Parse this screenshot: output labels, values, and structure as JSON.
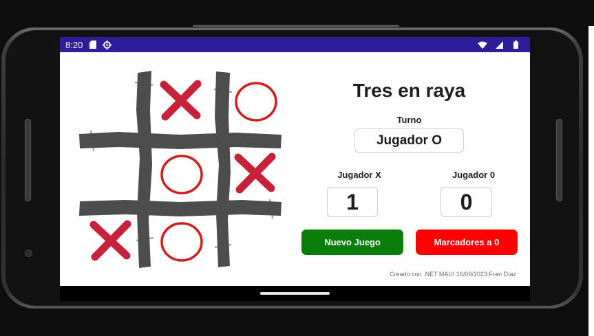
{
  "status_bar": {
    "time": "8:20",
    "left_icons": [
      "sd-card-icon",
      "settings-gear-icon"
    ],
    "right_icons": [
      "wifi-icon",
      "cell-signal-icon",
      "battery-icon"
    ]
  },
  "app": {
    "title": "Tres en raya",
    "turn_label": "Turno",
    "turn_value": "Jugador O",
    "player_x_label": "Jugador X",
    "player_x_score": "1",
    "player_o_label": "Jugador 0",
    "player_o_score": "0",
    "new_game_label": "Nuevo Juego",
    "reset_scores_label": "Marcadores a 0",
    "footer": "Creado con .NET MAUI 16/09/2023 Fran Díaz"
  },
  "board": {
    "cells": [
      "",
      "X",
      "O",
      "",
      "O",
      "X",
      "X",
      "O",
      ""
    ]
  },
  "colors": {
    "status_bar": "#2e1d99",
    "grid": "#4d4d4d",
    "mark_x": "#c8213a",
    "mark_o": "#d31c1c",
    "new_game_button": "#0a7d0a",
    "reset_button": "#ff0000"
  }
}
